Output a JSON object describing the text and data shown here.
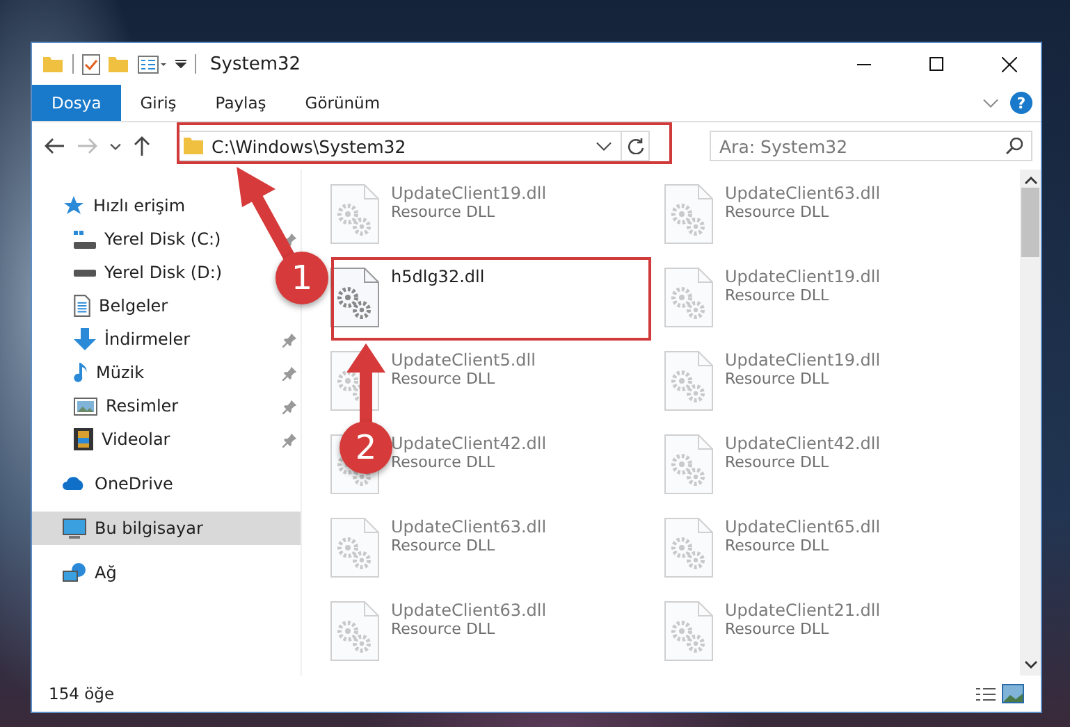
{
  "window": {
    "title": "System32"
  },
  "ribbon_tabs": [
    {
      "label": "Dosya",
      "selected": true
    },
    {
      "label": "Giriş",
      "selected": false
    },
    {
      "label": "Paylaş",
      "selected": false
    },
    {
      "label": "Görünüm",
      "selected": false
    }
  ],
  "help": "?",
  "address": {
    "path": "C:\\Windows\\System32",
    "back_disabled": false,
    "forward_disabled": true
  },
  "search": {
    "placeholder": "Ara: System32"
  },
  "sidebar": {
    "items": [
      {
        "label": "Hızlı erişim",
        "kind": "star",
        "selected": false,
        "children": [
          {
            "label": "Yerel Disk (C:)",
            "kind": "drive-win",
            "pinned": true,
            "selected": false
          },
          {
            "label": "Yerel Disk (D:)",
            "kind": "drive",
            "selected": false
          },
          {
            "label": "Belgeler",
            "kind": "docs",
            "selected": false
          },
          {
            "label": "İndirmeler",
            "kind": "download",
            "pinned": true,
            "selected": false
          },
          {
            "label": "Müzik",
            "kind": "music",
            "pinned": true,
            "selected": false
          },
          {
            "label": "Resimler",
            "kind": "pictures",
            "pinned": true,
            "selected": false
          },
          {
            "label": "Videolar",
            "kind": "video",
            "pinned": true,
            "selected": false
          }
        ]
      },
      {
        "label": "OneDrive",
        "kind": "cloud",
        "selected": false
      },
      {
        "label": "Bu bilgisayar",
        "kind": "pc",
        "selected": true
      },
      {
        "label": "Ağ",
        "kind": "network",
        "selected": false
      }
    ]
  },
  "files": [
    {
      "name": "UpdateClient19.dll",
      "type": "Resource DLL",
      "faded": true
    },
    {
      "name": "UpdateClient63.dll",
      "type": "Resource DLL",
      "faded": true
    },
    {
      "name": "h5dlg32.dll",
      "faded": false
    },
    {
      "name": "UpdateClient19.dll",
      "type": "Resource DLL",
      "faded": true
    },
    {
      "name": "UpdateClient5.dll",
      "type": "Resource DLL",
      "faded": true
    },
    {
      "name": "UpdateClient19.dll",
      "type": "Resource DLL",
      "faded": true
    },
    {
      "name": "UpdateClient42.dll",
      "type": "Resource DLL",
      "faded": true
    },
    {
      "name": "UpdateClient42.dll",
      "type": "Resource DLL",
      "faded": true
    },
    {
      "name": "UpdateClient63.dll",
      "type": "Resource DLL",
      "faded": true
    },
    {
      "name": "UpdateClient65.dll",
      "type": "Resource DLL",
      "faded": true
    },
    {
      "name": "UpdateClient63.dll",
      "type": "Resource DLL",
      "faded": true
    },
    {
      "name": "UpdateClient21.dll",
      "type": "Resource DLL",
      "faded": true
    }
  ],
  "status_bar": {
    "count": "154 öğe"
  },
  "annotations": [
    {
      "number": "1"
    },
    {
      "number": "2"
    }
  ]
}
